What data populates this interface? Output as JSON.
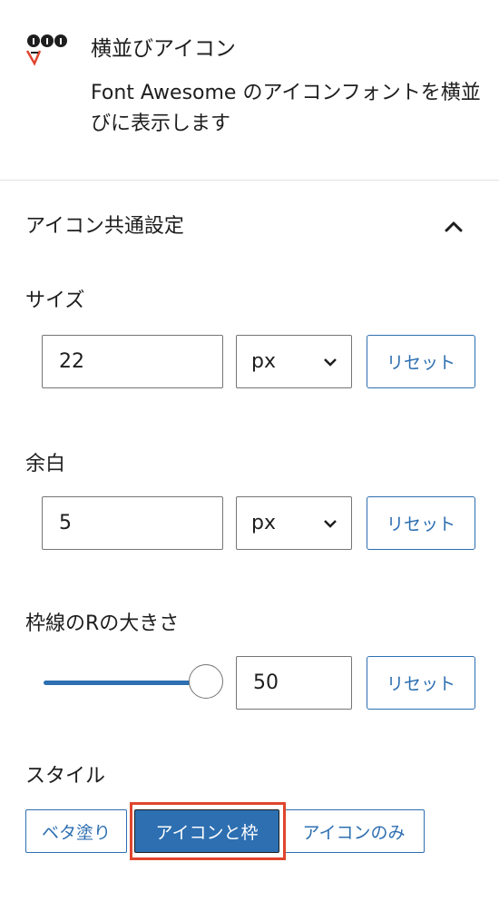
{
  "block": {
    "icon": "font-awesome-block-icon",
    "title": "横並びアイコン",
    "description": "Font Awesome のアイコンフォントを横並びに表示します"
  },
  "panel": {
    "title": "アイコン共通設定",
    "toggle_icon": "chevron-up-icon",
    "expanded": true
  },
  "size": {
    "label": "サイズ",
    "value": "22",
    "unit": "px",
    "reset_label": "リセット"
  },
  "margin": {
    "label": "余白",
    "value": "5",
    "unit": "px",
    "reset_label": "リセット"
  },
  "border_radius": {
    "label": "枠線のRの大きさ",
    "slider_fraction": 1.0,
    "value": "50",
    "reset_label": "リセット"
  },
  "style": {
    "label": "スタイル",
    "options": [
      "ベタ塗り",
      "アイコンと枠",
      "アイコンのみ"
    ],
    "selected": "アイコンと枠"
  },
  "colors": {
    "accent": "#2d6fb1",
    "highlight": "#e0452e",
    "text": "#1e1e1e",
    "border": "#757575"
  }
}
